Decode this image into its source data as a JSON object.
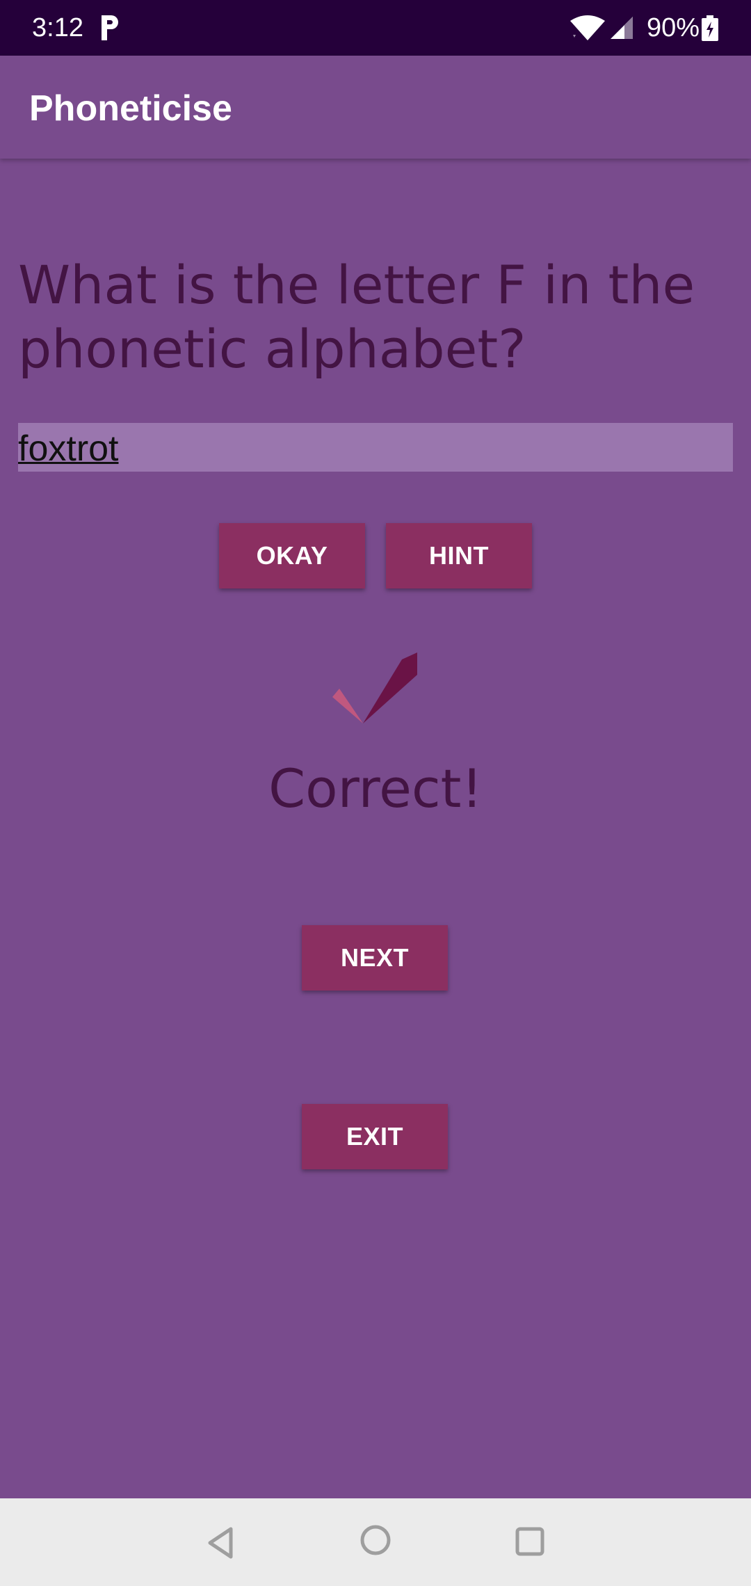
{
  "status_bar": {
    "time": "3:12",
    "battery_percent": "90%",
    "icons": [
      "parking-app-icon",
      "wifi-icon",
      "cell-signal-icon",
      "battery-charging-icon"
    ]
  },
  "app_bar": {
    "title": "Phoneticise"
  },
  "quiz": {
    "question": "What is the letter F in the phonetic alphabet?",
    "answer_value": "foxtrot",
    "okay_label": "OKAY",
    "hint_label": "HINT",
    "result_icon": "checkmark-icon",
    "result_text": "Correct!",
    "next_label": "NEXT",
    "exit_label": "EXIT"
  },
  "nav_bar": {
    "icons": [
      "back-icon",
      "home-icon",
      "recents-icon"
    ]
  },
  "colors": {
    "background": "#794b8d",
    "status_bar": "#25003a",
    "button": "#8b2f61",
    "text_dark": "#3e0f3b",
    "input_bg": "#9a76ae",
    "nav_bar": "#ebebeb"
  }
}
